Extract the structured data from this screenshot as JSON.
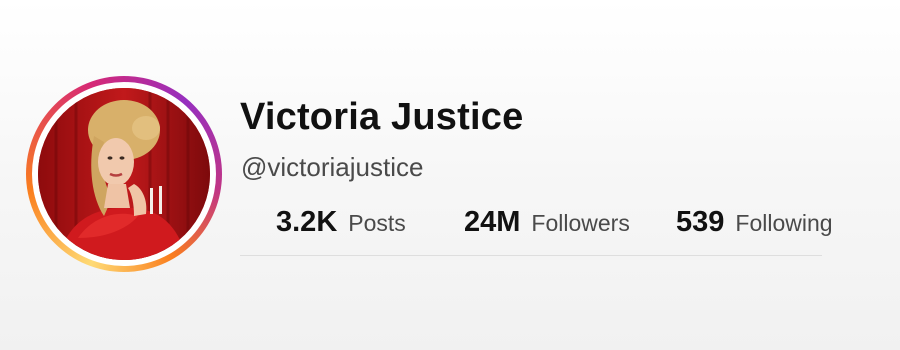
{
  "profile": {
    "display_name": "Victoria Justice",
    "username": "@victoriajustice",
    "avatar_icon": "profile-photo",
    "story_ring_colors": [
      "#feda75",
      "#fa7e1e",
      "#d62976",
      "#962fbf"
    ]
  },
  "stats": [
    {
      "value": "3.2K",
      "label": "Posts"
    },
    {
      "value": "24M",
      "label": "Followers"
    },
    {
      "value": "539",
      "label": "Following"
    }
  ]
}
